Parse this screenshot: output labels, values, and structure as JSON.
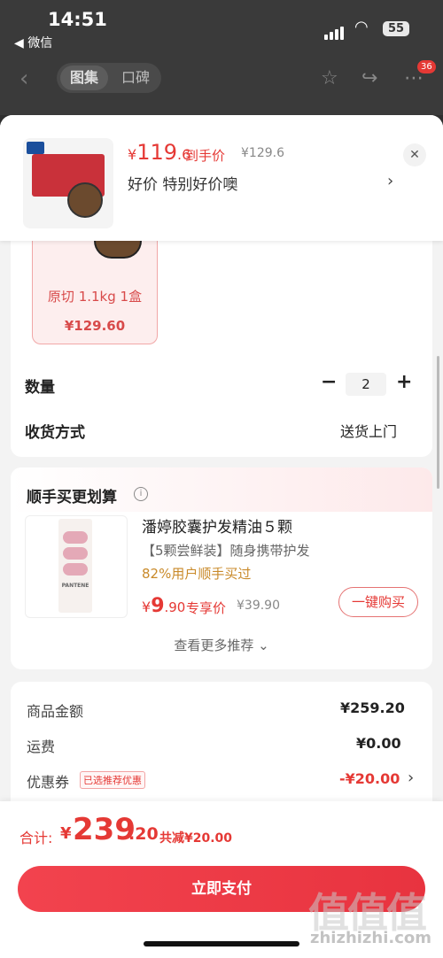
{
  "status_bar": {
    "time": "14:51",
    "back_app": "◀ 微信",
    "battery": "55"
  },
  "nav": {
    "tabs": [
      "图集",
      "口碑"
    ],
    "badge": "36"
  },
  "product_header": {
    "price_symbol": "¥",
    "price_int": "119",
    "price_dec": ".6",
    "price_tag": "到手价",
    "original_price": "¥129.6",
    "promo_text": "好价  特别好价噢"
  },
  "sku": {
    "name": "原切 1.1kg 1盒",
    "price": "¥129.60"
  },
  "quantity": {
    "label": "数量",
    "value": "2"
  },
  "shipping": {
    "label": "收货方式",
    "value": "送货上门"
  },
  "upsell": {
    "title": "顺手买更划算",
    "product": {
      "brand_on_image": "PANTENE",
      "title": "潘婷胶囊护发精油５颗",
      "subtitle": "【5颗尝鲜装】随身携带护发",
      "stat": "82%用户顺手买过",
      "price_symbol": "¥",
      "price_int": "9",
      "price_dec": ".90",
      "price_tag": "专享价",
      "original_price": "¥39.90",
      "buy_label": "一键购买"
    },
    "more_label": "查看更多推荐"
  },
  "summary": {
    "goods_label": "商品金额",
    "goods_value": "¥259.20",
    "freight_label": "运费",
    "freight_value": "¥0.00",
    "coupon_label": "优惠券",
    "coupon_tag": "已选推荐优惠",
    "coupon_value": "-¥20.00"
  },
  "footer": {
    "total_label": "合计:",
    "total_symbol": "¥",
    "total_int": "239",
    "total_dec": ".20",
    "saved": "共减¥20.00",
    "pay_label": "立即支付"
  },
  "watermark": {
    "logo_text": "值值值",
    "url": "zhizhizhi.com"
  },
  "colors": {
    "accent": "#e53935",
    "pay_button": "#f2434e",
    "stat": "#c98a2a"
  }
}
